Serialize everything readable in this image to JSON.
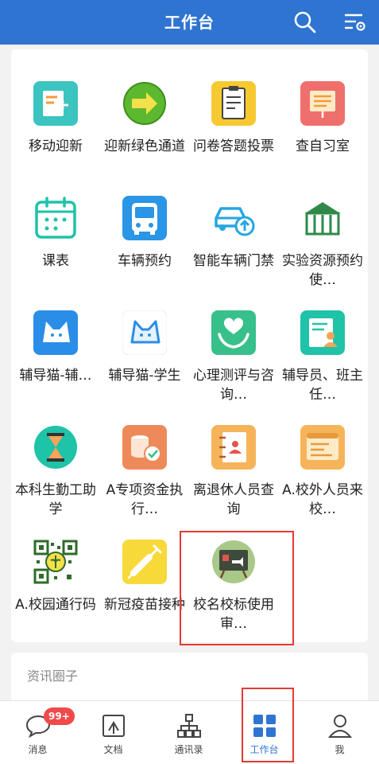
{
  "header": {
    "title": "工作台",
    "search_icon": "search-icon",
    "filter_icon": "filter-settings-icon",
    "bg_color": "#2f74d0"
  },
  "apps": [
    {
      "label": "移动迎新",
      "icon": "mobile-welcome-icon"
    },
    {
      "label": "迎新绿色通道",
      "icon": "green-channel-arrow-icon"
    },
    {
      "label": "问卷答题投票",
      "icon": "questionnaire-clipboard-icon"
    },
    {
      "label": "查自习室",
      "icon": "study-room-board-icon"
    },
    {
      "label": "课表",
      "icon": "calendar-icon"
    },
    {
      "label": "车辆预约",
      "icon": "bus-icon"
    },
    {
      "label": "智能车辆门禁",
      "icon": "car-access-icon"
    },
    {
      "label": "实验资源预约使…",
      "icon": "lab-building-icon"
    },
    {
      "label": "辅导猫-辅…",
      "icon": "cat-icon"
    },
    {
      "label": "辅导猫-学生",
      "icon": "cat-outline-icon"
    },
    {
      "label": "心理测评与咨询…",
      "icon": "heart-hand-icon"
    },
    {
      "label": "辅导员、班主任…",
      "icon": "counselor-card-icon"
    },
    {
      "label": "本科生勤工助学",
      "icon": "hourglass-icon"
    },
    {
      "label": "A专项资金执行…",
      "icon": "coins-icon"
    },
    {
      "label": "离退休人员查询",
      "icon": "contact-book-icon"
    },
    {
      "label": "A.校外人员来校…",
      "icon": "browser-window-icon"
    },
    {
      "label": "A.校园通行码",
      "icon": "qr-code-icon"
    },
    {
      "label": "新冠疫苗接种",
      "icon": "vaccine-syringe-icon"
    },
    {
      "label": "校名校标使用审…",
      "icon": "presentation-board-icon"
    }
  ],
  "news": {
    "title": "资讯圈子"
  },
  "tabbar": {
    "items": [
      {
        "label": "消息",
        "icon": "chat-bubble-icon"
      },
      {
        "label": "文档",
        "icon": "document-icon"
      },
      {
        "label": "通讯录",
        "icon": "org-chart-icon"
      },
      {
        "label": "工作台",
        "icon": "grid-icon",
        "active": true
      },
      {
        "label": "我",
        "icon": "person-icon"
      }
    ],
    "badge": "99+",
    "active_color": "#2f74d0"
  },
  "highlight_color": "#e53935"
}
